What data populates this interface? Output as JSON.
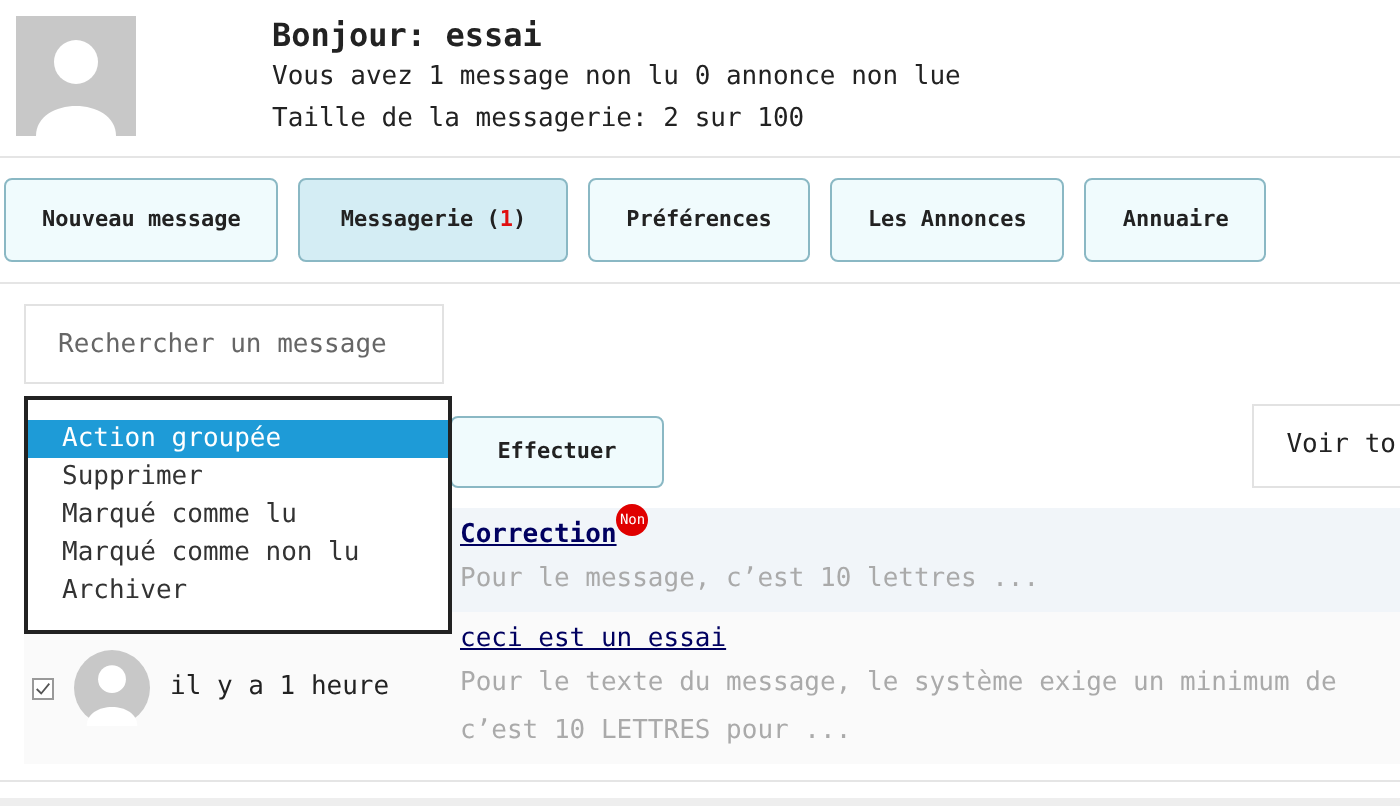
{
  "header": {
    "greeting": "Bonjour: essai",
    "unread_line": "Vous avez 1 message non lu 0 annonce non lue",
    "size_line": "Taille de la messagerie: 2 sur 100"
  },
  "nav": [
    {
      "label": "Nouveau message",
      "selected": false
    },
    {
      "label": "Messagerie (",
      "count": "1",
      "suffix": ")",
      "selected": true
    },
    {
      "label": "Préférences",
      "selected": false
    },
    {
      "label": "Les Annonces",
      "selected": false
    },
    {
      "label": "Annuaire",
      "selected": false
    }
  ],
  "search": {
    "placeholder": "Rechercher un message"
  },
  "bulk_action": {
    "expanded": true,
    "options": [
      {
        "label": "Action groupée",
        "selected": true
      },
      {
        "label": "Supprimer",
        "selected": false
      },
      {
        "label": "Marqué comme lu",
        "selected": false
      },
      {
        "label": "Marqué comme non lu",
        "selected": false
      },
      {
        "label": "Archiver",
        "selected": false
      }
    ]
  },
  "apply_button": "Effectuer",
  "view_all_button": "Voir to",
  "messages": [
    {
      "title": "Correction",
      "unread": true,
      "badge": "Non",
      "preview": [
        "Pour le message, c’est 10 lettres ..."
      ]
    },
    {
      "checked": true,
      "time": "il y a 1 heure",
      "title": "ceci est un essai",
      "unread": false,
      "preview": [
        "Pour le texte du message, le système exige un minimum de",
        "c’est 10 LETTRES pour ..."
      ]
    }
  ]
}
